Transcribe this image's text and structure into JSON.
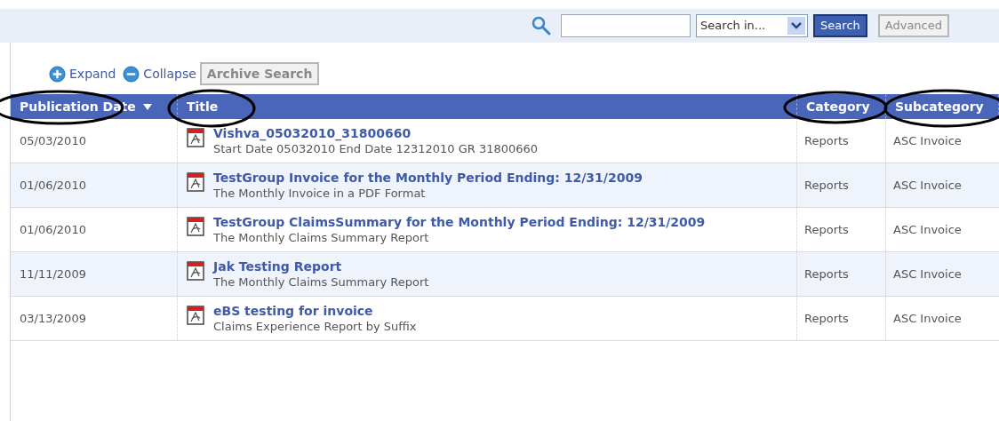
{
  "search_bar": {
    "scope_placeholder": "Search in...",
    "search_button": "Search",
    "advanced_button": "Advanced"
  },
  "toolbar": {
    "expand": "Expand",
    "collapse": "Collapse",
    "archive_search": "Archive Search"
  },
  "table": {
    "columns": [
      {
        "label": "Publication Date",
        "sorted": true
      },
      {
        "label": "Title",
        "sorted": false
      },
      {
        "label": "Category",
        "sorted": false
      },
      {
        "label": "Subcategory",
        "sorted": false
      }
    ],
    "rows": [
      {
        "date": "05/03/2010",
        "title": "Vishva_05032010_31800660",
        "description": "Start Date 05032010 End Date 12312010 GR 31800660",
        "category": "Reports",
        "subcategory": "ASC Invoice"
      },
      {
        "date": "01/06/2010",
        "title": "TestGroup Invoice for the Monthly Period Ending: 12/31/2009",
        "description": "The Monthly Invoice in a PDF Format",
        "category": "Reports",
        "subcategory": "ASC Invoice"
      },
      {
        "date": "01/06/2010",
        "title": "TestGroup ClaimsSummary for the Monthly Period Ending: 12/31/2009",
        "description": "The Monthly Claims Summary Report",
        "category": "Reports",
        "subcategory": "ASC Invoice"
      },
      {
        "date": "11/11/2009",
        "title": "Jak Testing Report",
        "description": "The Monthly Claims Summary Report",
        "category": "Reports",
        "subcategory": "ASC Invoice"
      },
      {
        "date": "03/13/2009",
        "title": "eBS testing for invoice",
        "description": "Claims Experience Report by Suffix",
        "category": "Reports",
        "subcategory": "ASC Invoice"
      }
    ]
  }
}
